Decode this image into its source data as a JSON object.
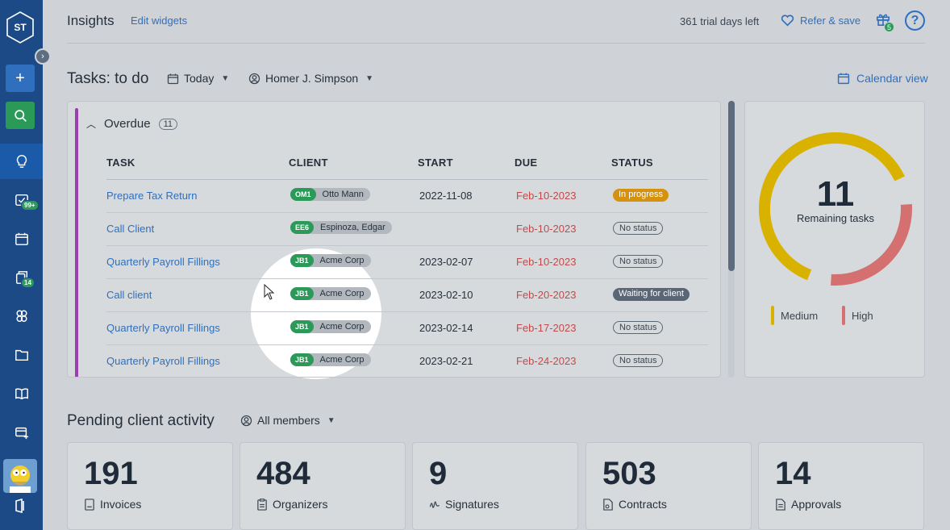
{
  "sidebar": {
    "logo_text": "ST",
    "add_label": "+",
    "badges": {
      "tasks": "99+",
      "documents": "14"
    }
  },
  "header": {
    "title": "Insights",
    "edit_widgets": "Edit widgets",
    "trial": "361 trial days left",
    "refer": "Refer & save",
    "gift_count": "5",
    "help": "?"
  },
  "tasks": {
    "title": "Tasks: to do",
    "date_filter": "Today",
    "assignee_filter": "Homer J. Simpson",
    "calendar_view": "Calendar view",
    "group_label": "Overdue",
    "group_count": "11",
    "columns": [
      "TASK",
      "CLIENT",
      "START",
      "DUE",
      "STATUS"
    ],
    "rows": [
      {
        "task": "Prepare Tax Return",
        "client_code": "OM1",
        "client": "Otto Mann",
        "start": "2022-11-08",
        "due": "Feb-10-2023",
        "status": "In progress"
      },
      {
        "task": "Call Client",
        "client_code": "EE6",
        "client": "Espinoza, Edgar",
        "start": "",
        "due": "Feb-10-2023",
        "status": "No status"
      },
      {
        "task": "Quarterly Payroll Fillings",
        "client_code": "JB1",
        "client": "Acme Corp",
        "start": "2023-02-07",
        "due": "Feb-10-2023",
        "status": "No status"
      },
      {
        "task": "Call client",
        "client_code": "JB1",
        "client": "Acme Corp",
        "start": "2023-02-10",
        "due": "Feb-20-2023",
        "status": "Waiting for client"
      },
      {
        "task": "Quarterly Payroll Fillings",
        "client_code": "JB1",
        "client": "Acme Corp",
        "start": "2023-02-14",
        "due": "Feb-17-2023",
        "status": "No status"
      },
      {
        "task": "Quarterly Payroll Fillings",
        "client_code": "JB1",
        "client": "Acme Corp",
        "start": "2023-02-21",
        "due": "Feb-24-2023",
        "status": "No status"
      }
    ]
  },
  "summary": {
    "remaining": "11",
    "remaining_label": "Remaining tasks",
    "legend": [
      {
        "name": "Medium",
        "color": "#d9b200"
      },
      {
        "name": "High",
        "color": "#d47070"
      }
    ],
    "share": {
      "Medium": 0.62,
      "High": 0.27
    }
  },
  "pending": {
    "title": "Pending client activity",
    "filter": "All members",
    "stats": [
      {
        "value": "191",
        "label": "Invoices"
      },
      {
        "value": "484",
        "label": "Organizers"
      },
      {
        "value": "9",
        "label": "Signatures"
      },
      {
        "value": "503",
        "label": "Contracts"
      },
      {
        "value": "14",
        "label": "Approvals"
      }
    ]
  },
  "colors": {
    "sidebar": "#1c4a86",
    "accent": "#2f6fbd",
    "green": "#2b9a59",
    "overdue": "#c24a4a"
  }
}
